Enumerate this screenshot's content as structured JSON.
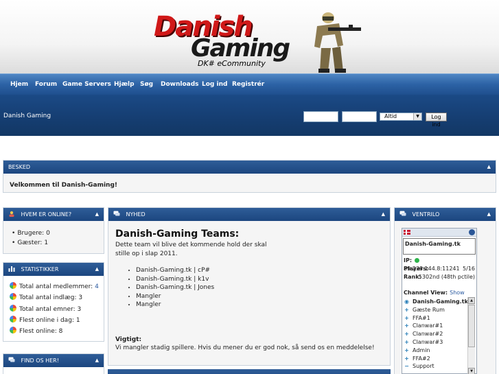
{
  "logo": {
    "line1": "Danish",
    "line2": "Gaming",
    "tagline": "DK# eCommunity"
  },
  "nav": [
    "Hjem",
    "Forum",
    "Game Servers",
    "Hjælp",
    "Søg",
    "Downloads",
    "Log ind",
    "Registrér"
  ],
  "site_name": "Danish Gaming",
  "login": {
    "select_value": "Altid",
    "button": "Log ind"
  },
  "besked": {
    "title": "BESKED",
    "message": "Velkommen til Danish-Gaming!"
  },
  "online": {
    "title": "HVEM ER ONLINE?",
    "items": [
      "Brugere: 0",
      "Gæster: 1"
    ]
  },
  "stats": {
    "title": "STATISTIKKER",
    "items": [
      {
        "label": "Total antal medlemmer:",
        "value": "4"
      },
      {
        "label": "Total antal indlæg:",
        "value": "3"
      },
      {
        "label": "Total antal emner:",
        "value": "3"
      },
      {
        "label": "Flest online i dag:",
        "value": "1"
      },
      {
        "label": "Flest online:",
        "value": "8"
      }
    ]
  },
  "find": {
    "title": "FIND OS HER!"
  },
  "news": {
    "title": "NYHED",
    "heading": "Danish-Gaming Teams:",
    "intro": "Dette team vil blive det kommende hold der skal stille op i slap 2011.",
    "items": [
      "Danish-Gaming.tk | cP#",
      "Danish-Gaming.tk | k1v",
      "Danish-Gaming.tk | Jones",
      "Mangler",
      "Mangler"
    ],
    "sub_heading": "Vigtigt:",
    "body": "Vi mangler stadig spillere. Hvis du mener du er god nok, så send os en meddelelse!"
  },
  "ventrilo": {
    "title": "VENTRILO",
    "server_name": "Danish-Gaming.tk",
    "ip_label": "IP:",
    "ip": "89.238.144.8:11241",
    "players_label": "Players:",
    "players": "5/16",
    "rank_label": "Rank:",
    "rank": "5302nd (48th pctile)",
    "channel_view_label": "Channel View:",
    "show_label": "Show",
    "tree_root": "Danish-Gaming.tk",
    "channels": [
      "Gæste Rum",
      "FFA#1",
      "Clanwar#1",
      "Clanwar#2",
      "Clanwar#3",
      "Admin",
      "FFA#2",
      "Support"
    ]
  }
}
